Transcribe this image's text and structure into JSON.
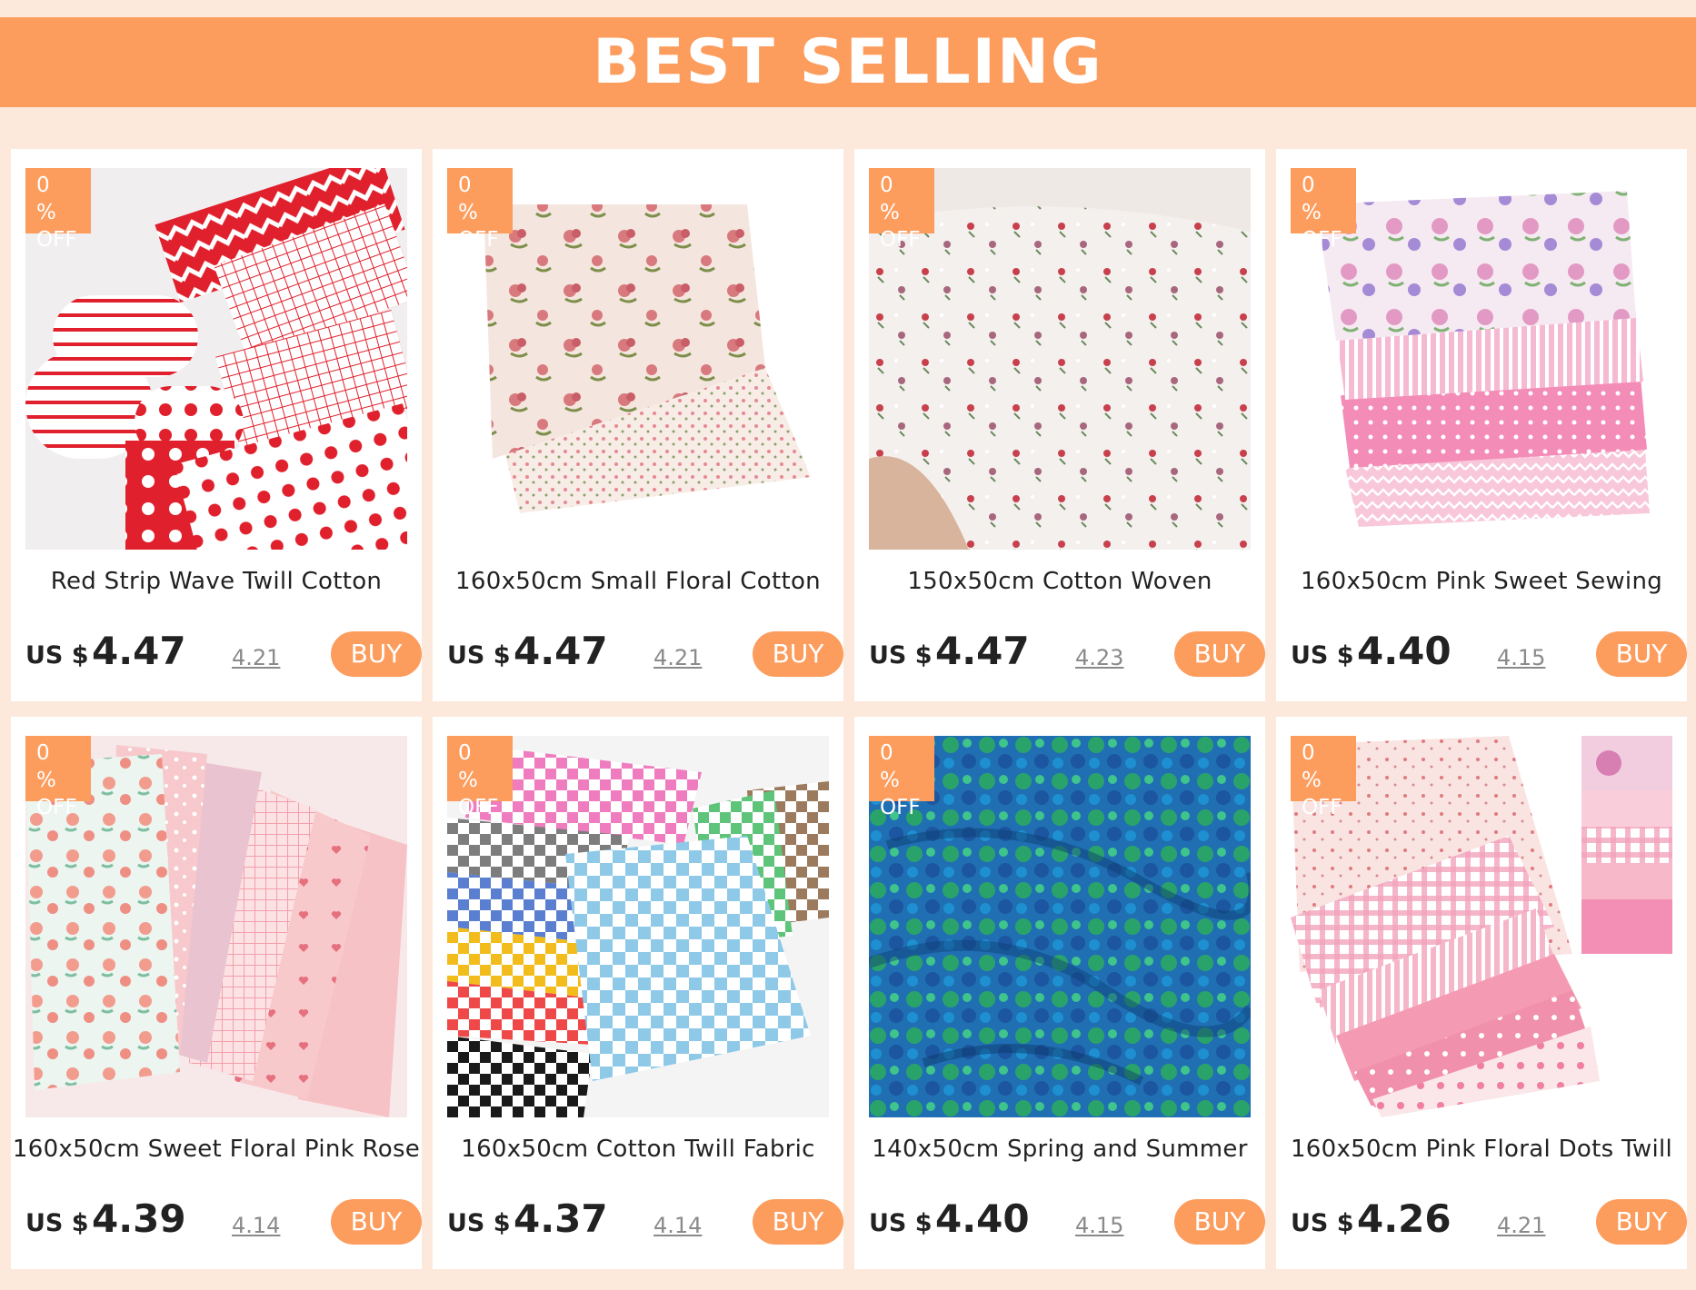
{
  "banner": {
    "title": "BEST SELLING"
  },
  "colors": {
    "accent": "#fc9c5d",
    "background": "#fde9dc"
  },
  "products": [
    {
      "badge_pct": "0 %",
      "badge_off": "OFF",
      "title": "Red Strip Wave Twill Cotton",
      "currency": "US $",
      "price": "4.47",
      "old_price": "4.21",
      "buy_label": "BUY"
    },
    {
      "badge_pct": "0 %",
      "badge_off": "OFF",
      "title": "160x50cm Small Floral Cotton",
      "currency": "US $",
      "price": "4.47",
      "old_price": "4.21",
      "buy_label": "BUY"
    },
    {
      "badge_pct": "0 %",
      "badge_off": "OFF",
      "title": "150x50cm Cotton Woven",
      "currency": "US $",
      "price": "4.47",
      "old_price": "4.23",
      "buy_label": "BUY"
    },
    {
      "badge_pct": "0 %",
      "badge_off": "OFF",
      "title": "160x50cm Pink Sweet Sewing",
      "currency": "US $",
      "price": "4.40",
      "old_price": "4.15",
      "buy_label": "BUY"
    },
    {
      "badge_pct": "0 %",
      "badge_off": "OFF",
      "title": "160x50cm Sweet Floral Pink Rose",
      "currency": "US $",
      "price": "4.39",
      "old_price": "4.14",
      "buy_label": "BUY"
    },
    {
      "badge_pct": "0 %",
      "badge_off": "OFF",
      "title": "160x50cm Cotton Twill Fabric",
      "currency": "US $",
      "price": "4.37",
      "old_price": "4.14",
      "buy_label": "BUY"
    },
    {
      "badge_pct": "0 %",
      "badge_off": "OFF",
      "title": "140x50cm Spring and Summer",
      "currency": "US $",
      "price": "4.40",
      "old_price": "4.15",
      "buy_label": "BUY"
    },
    {
      "badge_pct": "0 %",
      "badge_off": "OFF",
      "title": "160x50cm Pink Floral Dots Twill",
      "currency": "US $",
      "price": "4.26",
      "old_price": "4.21",
      "buy_label": "BUY"
    }
  ]
}
